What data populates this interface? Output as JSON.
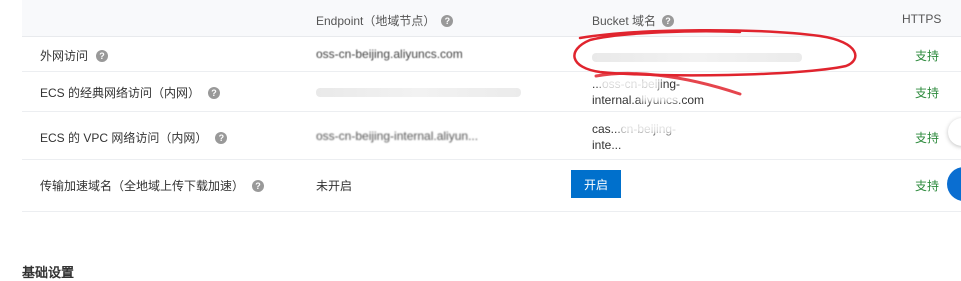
{
  "table": {
    "headers": {
      "endpoint": "Endpoint（地域节点）",
      "bucket": "Bucket 域名",
      "https": "HTTPS"
    },
    "rows": [
      {
        "label": "外网访问",
        "endpoint": "oss-cn-beijing.aliyuncs.com",
        "bucket": "",
        "https": "支持"
      },
      {
        "label": "ECS 的经典网络访问（内网）",
        "endpoint": "",
        "bucket_line1": "...oss-cn-beijing-",
        "bucket_line2": "internal.aliyuncs.com",
        "https": "支持"
      },
      {
        "label": "ECS 的 VPC 网络访问（内网）",
        "endpoint": "oss-cn-beijing-internal.aliyun...",
        "bucket_line1": "cas...cn-beijing-",
        "bucket_line2": "inte...",
        "https": "支持"
      },
      {
        "label": "传输加速域名（全地域上传下载加速）",
        "endpoint": "未开启",
        "button": "开启",
        "https": "支持"
      }
    ]
  },
  "section_title": "基础设置",
  "colors": {
    "accent": "#0070cc",
    "success": "#2e8b3e",
    "annotation": "#e0242e"
  },
  "icons": {
    "help": "question-circle-icon"
  }
}
